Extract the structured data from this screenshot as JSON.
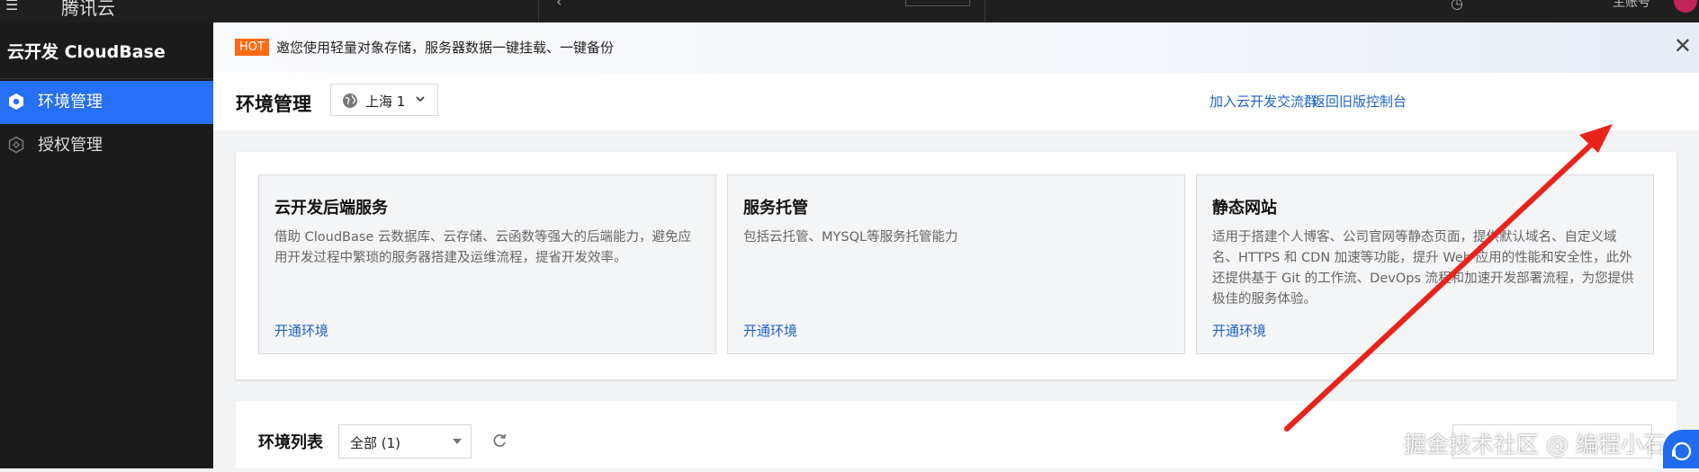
{
  "topbar": {
    "menu_icon": "menu-icon",
    "logo_text": "腾讯云",
    "account_label": "主账号"
  },
  "sidebar": {
    "brand": "云开发 CloudBase",
    "items": [
      {
        "label": "环境管理",
        "icon": "hexagon-icon",
        "active": true
      },
      {
        "label": "授权管理",
        "icon": "auth-icon",
        "active": false
      }
    ]
  },
  "banner": {
    "badge": "HOT",
    "text": "邀您使用轻量对象存储，服务器数据一键挂载、一键备份"
  },
  "header": {
    "title": "环境管理",
    "region": "上海 1",
    "links": [
      "加入云开发交流群",
      "返回旧版控制台"
    ]
  },
  "services": [
    {
      "title": "云开发后端服务",
      "desc": "借助 CloudBase 云数据库、云存储、云函数等强大的后端能力，避免应用开发过程中繁琐的服务器搭建及运维流程，提省开发效率。",
      "link": "开通环境"
    },
    {
      "title": "服务托管",
      "desc": "包括云托管、MYSQL等服务托管能力",
      "link": "开通环境"
    },
    {
      "title": "静态网站",
      "desc": "适用于搭建个人博客、公司官网等静态页面，提供默认域名、自定义域名、HTTPS 和 CDN 加速等功能，提升 Web 应用的性能和安全性，此外还提供基于 Git 的工作流、DevOps 流程和加速开发部署流程，为您提供极佳的服务体验。",
      "link": "开通环境"
    }
  ],
  "env_list": {
    "title": "环境列表",
    "filter": "全部 (1)"
  },
  "watermark": "掘金技术社区 @ 编程小石头",
  "colors": {
    "accent": "#2670f5",
    "link": "#1f62c9",
    "hot": "#ff6a13",
    "arrow": "#e8231b"
  }
}
